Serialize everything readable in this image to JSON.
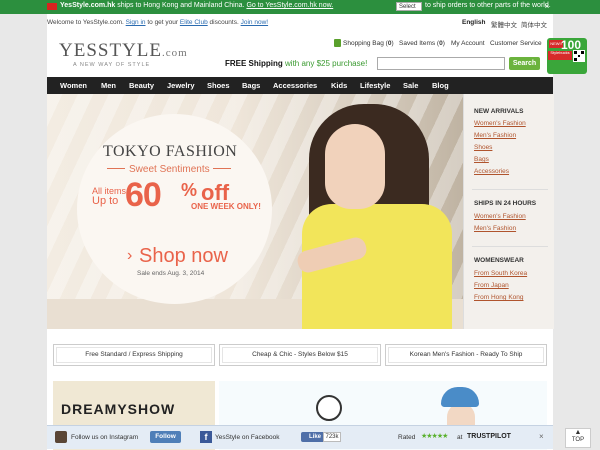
{
  "shipping_bar": {
    "site": "YesStyle.com.hk",
    "text": "ships to Hong Kong and Mainland China.",
    "link": "Go to YesStyle.com.hk now.",
    "select_label": "Select",
    "select_text": "to ship orders to other parts of the world.",
    "close": "×"
  },
  "util": {
    "welcome": "Welcome to YesStyle.com.",
    "sign_in": "Sign in",
    "get": "to get your",
    "elite": "Elite Club",
    "discounts": "discounts.",
    "join": "Join now!",
    "languages": [
      "English",
      "繁體中文",
      "简体中文"
    ]
  },
  "logo": {
    "name": "YESSTYLE",
    "com": ".com",
    "tagline": "A NEW WAY OF STYLE"
  },
  "account": {
    "bag_label": "Shopping Bag (",
    "bag_count": "0",
    "saved_label": "Saved Items (",
    "saved_count": "0",
    "close_paren": ")",
    "my_account": "My Account",
    "service": "Customer Service"
  },
  "promo_header": {
    "free": "FREE Shipping",
    "rest": "with any $25 purchase!"
  },
  "search": {
    "placeholder": "",
    "button": "Search"
  },
  "badge": {
    "top": "NEW!!",
    "number": "100",
    "sub": "Stylebucks"
  },
  "nav": [
    "Women",
    "Men",
    "Beauty",
    "Jewelry",
    "Shoes",
    "Bags",
    "Accessories",
    "Kids",
    "Lifestyle",
    "Sale",
    "Blog"
  ],
  "hero": {
    "title": "TOKYO FASHION",
    "subtitle": "Sweet Sentiments",
    "all_items": "All items",
    "up_to": "Up to",
    "discount": "60",
    "percent": "%",
    "off": "off",
    "week": "ONE WEEK ONLY!",
    "shop_now": "Shop now",
    "sale_ends": "Sale ends Aug. 3, 2014"
  },
  "right_panel": {
    "new_arrivals": {
      "heading": "NEW ARRIVALS",
      "links": [
        "Women's Fashion",
        "Men's Fashion",
        "Shoes",
        "Bags",
        "Accessories"
      ]
    },
    "ships": {
      "heading": "SHIPS IN 24 HOURS",
      "links": [
        "Women's Fashion",
        "Men's Fashion"
      ]
    },
    "womenswear": {
      "heading": "WOMENSWEAR",
      "links": [
        "From South Korea",
        "From Japan",
        "From Hong Kong"
      ]
    }
  },
  "promos": [
    "Free Standard / Express Shipping",
    "Cheap & Chic - Styles Below $15",
    "Korean Men's Fashion - Ready To Ship"
  ],
  "dreamy": {
    "title": "DREAMYSHOW"
  },
  "social": {
    "follow": "Follow us on Instagram",
    "follow_btn": "Follow",
    "fb": "YesStyle on Facebook",
    "like": "Like",
    "likes": "723k",
    "rated": "Rated",
    "stars": "★★★★★",
    "at": "at",
    "trustpilot": "TRUSTPILOT",
    "close": "×"
  },
  "top_button": {
    "arrow": "▲",
    "label": "TOP"
  },
  "colors": {
    "green": "#2c8f3e",
    "nav": "#222222",
    "accent": "#e9634a",
    "link": "#b0542d"
  }
}
